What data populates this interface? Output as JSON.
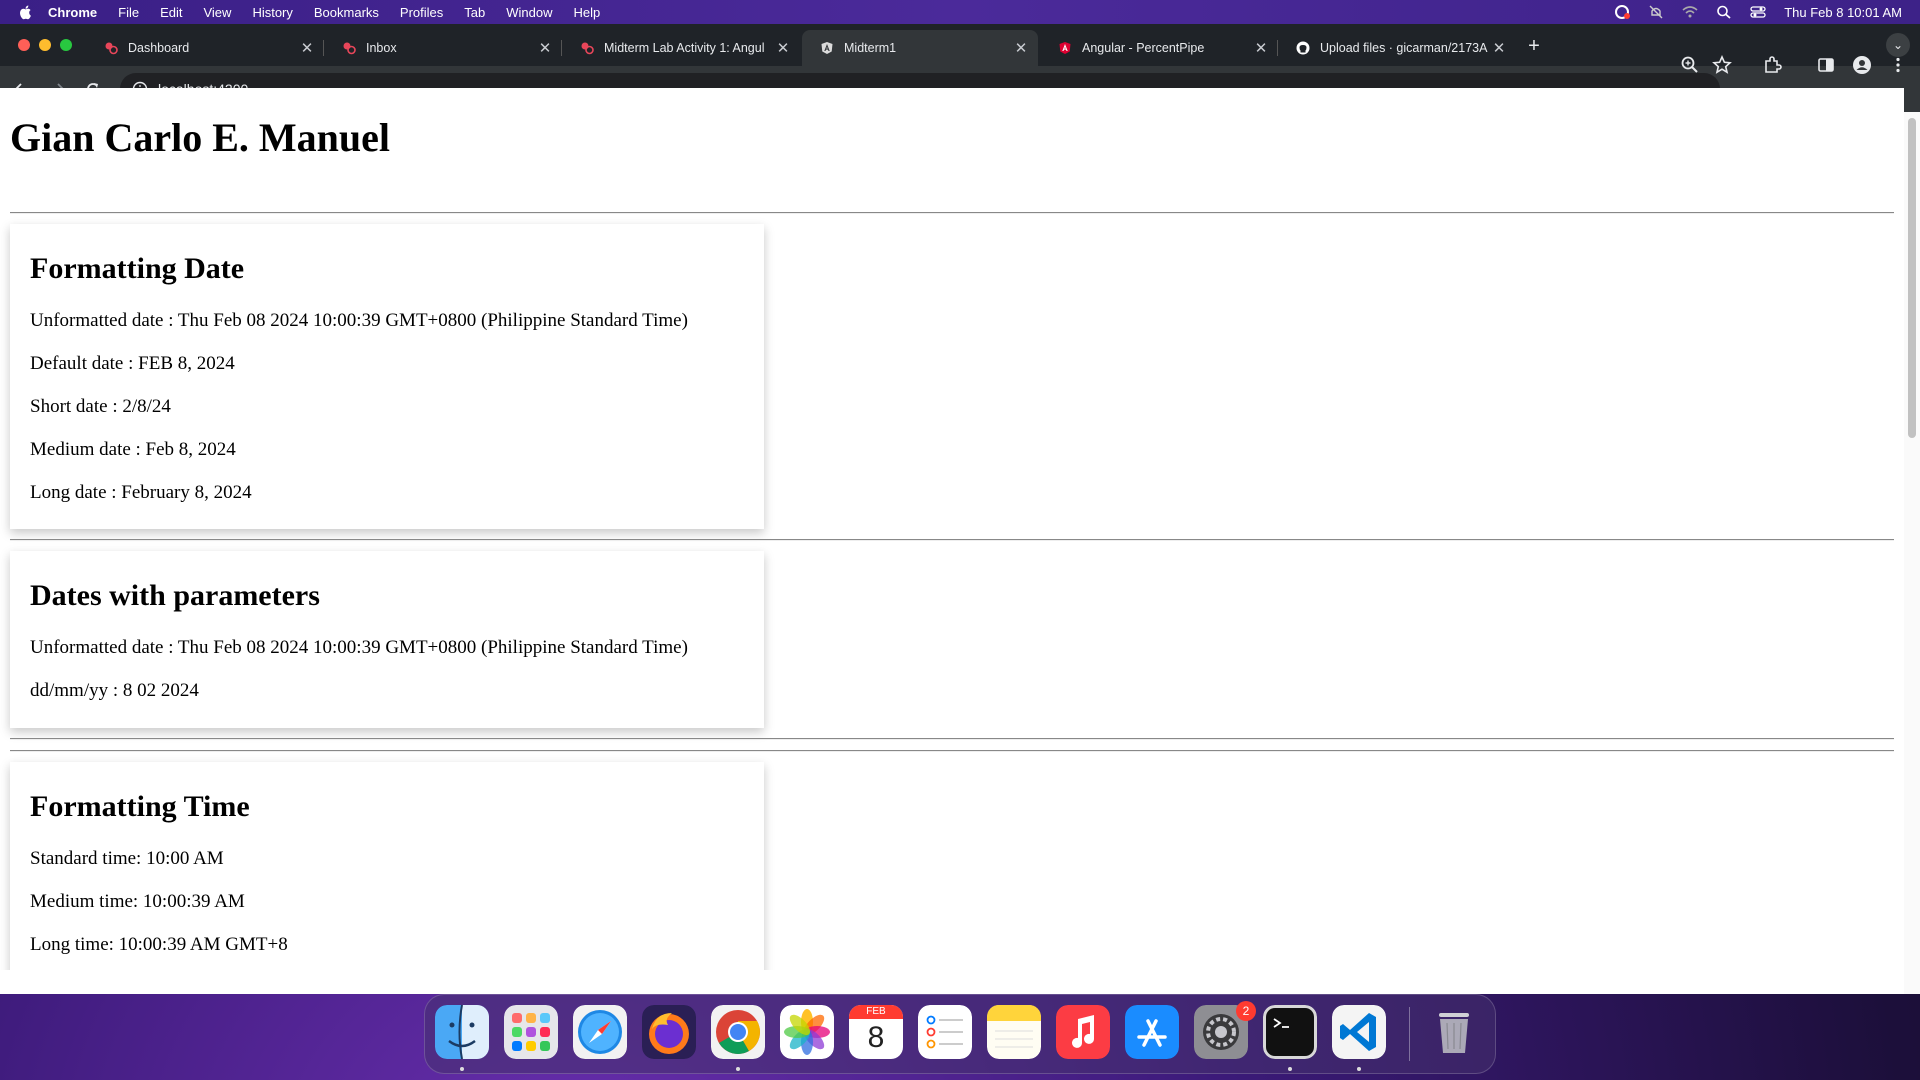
{
  "menubar": {
    "app": "Chrome",
    "items": [
      "File",
      "Edit",
      "View",
      "History",
      "Bookmarks",
      "Profiles",
      "Tab",
      "Window",
      "Help"
    ],
    "clock": "Thu Feb 8  10:01 AM"
  },
  "tabs": [
    {
      "title": "Dashboard",
      "icon": "app-favicon-icon",
      "active": false
    },
    {
      "title": "Inbox",
      "icon": "app-favicon-icon",
      "active": false
    },
    {
      "title": "Midterm Lab Activity 1: Angul",
      "icon": "app-favicon-icon",
      "active": false
    },
    {
      "title": "Midterm1",
      "icon": "angular-icon",
      "active": true
    },
    {
      "title": "Angular - PercentPipe",
      "icon": "angular-icon",
      "active": false
    },
    {
      "title": "Upload files · gicarman/2173A",
      "icon": "github-icon",
      "active": false
    }
  ],
  "toolbar": {
    "url": "localhost:4200"
  },
  "page": {
    "heading": "Gian Carlo E. Manuel",
    "sections": [
      {
        "title": "Formatting Date",
        "lines": [
          "Unformatted date : Thu Feb 08 2024 10:00:39 GMT+0800 (Philippine Standard Time)",
          "Default date : FEB 8, 2024",
          "Short date : 2/8/24",
          "Medium date : Feb 8, 2024",
          "Long date : February 8, 2024"
        ]
      },
      {
        "title": "Dates with parameters",
        "lines": [
          "Unformatted date : Thu Feb 08 2024 10:00:39 GMT+0800 (Philippine Standard Time)",
          "dd/mm/yy : 8 02 2024"
        ]
      },
      {
        "title": "Formatting Time",
        "lines": [
          "Standard time: 10:00 AM",
          "Medium time: 10:00:39 AM",
          "Long time: 10:00:39 AM GMT+8"
        ]
      }
    ]
  },
  "dock": {
    "calendar_month": "FEB",
    "calendar_day": "8",
    "settings_badge": "2",
    "apps": [
      "finder-icon",
      "launchpad-icon",
      "safari-icon",
      "firefox-icon",
      "chrome-icon",
      "photos-icon",
      "calendar-icon",
      "reminders-icon",
      "notes-icon",
      "music-icon",
      "app-store-icon",
      "system-settings-icon",
      "terminal-icon",
      "vscode-icon",
      "trash-icon"
    ]
  },
  "colors": {
    "tabstrip": "#1f2328",
    "toolbar": "#323639",
    "menubar": "#4b2a9a"
  }
}
